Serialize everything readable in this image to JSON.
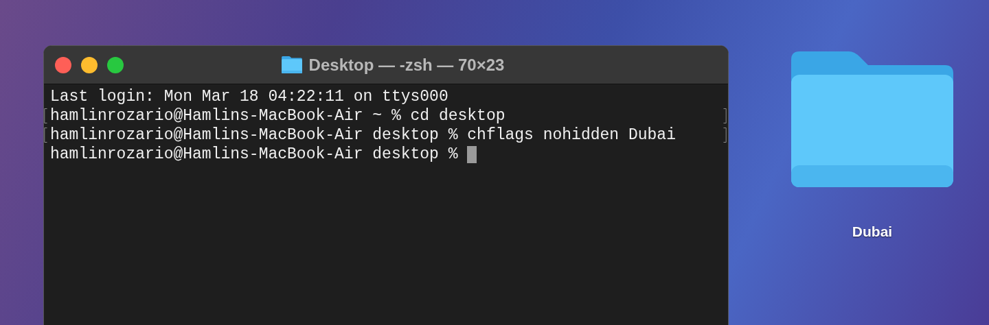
{
  "terminal": {
    "title": "Desktop — -zsh — 70×23",
    "lines": [
      {
        "text": "Last login: Mon Mar 18 04:22:11 on ttys000",
        "marked": false,
        "cursor": false
      },
      {
        "text": "hamlinrozario@Hamlins-MacBook-Air ~ % cd desktop",
        "marked": true,
        "cursor": false
      },
      {
        "text": "hamlinrozario@Hamlins-MacBook-Air desktop % chflags nohidden Dubai",
        "marked": true,
        "cursor": false
      },
      {
        "text": "hamlinrozario@Hamlins-MacBook-Air desktop % ",
        "marked": false,
        "cursor": true
      }
    ]
  },
  "desktop_icons": [
    {
      "label": "Dubai"
    }
  ]
}
